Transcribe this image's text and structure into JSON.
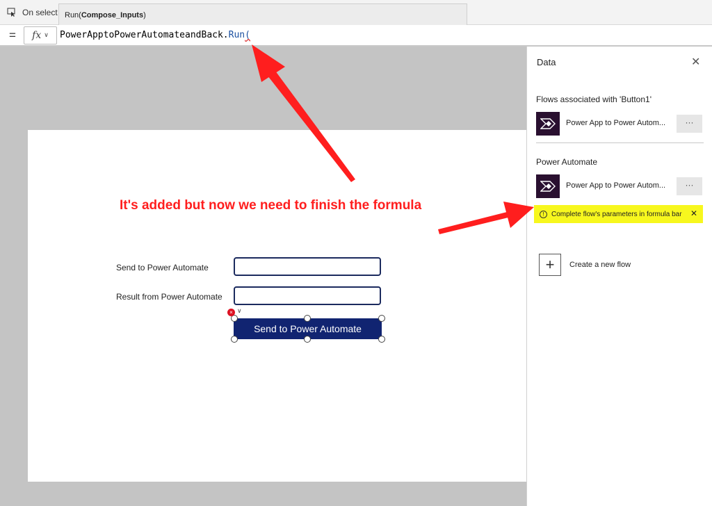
{
  "property_selector": {
    "label": "On select"
  },
  "tooltip": {
    "prefix": "Run(",
    "param": "Compose_Inputs",
    "suffix": ")"
  },
  "formula_bar": {
    "equals": "=",
    "fx": "fx",
    "formula_object": "PowerApptoPowerAutomateandBack.",
    "formula_fn": "Run",
    "formula_paren": "("
  },
  "screen": {
    "send_label": "Send to Power Automate",
    "result_label": "Result from Power Automate",
    "send_input_value": "",
    "result_input_value": "",
    "button_label": "Send to Power Automate"
  },
  "annotation": {
    "text": "It's added but now we need to finish the formula"
  },
  "data_panel": {
    "title": "Data",
    "section1_title": "Flows associated with 'Button1'",
    "section1_flow": "Power App to Power Autom...",
    "section2_title": "Power Automate",
    "section2_flow": "Power App to Power Autom...",
    "more_label": "···",
    "warning": "Complete flow's parameters in formula bar",
    "create_label": "Create a new flow"
  },
  "colors": {
    "annotation": "#ff1e1e",
    "button": "#112471",
    "warning_bg": "#f7f71e",
    "flow_icon_bg": "#2a1030"
  }
}
